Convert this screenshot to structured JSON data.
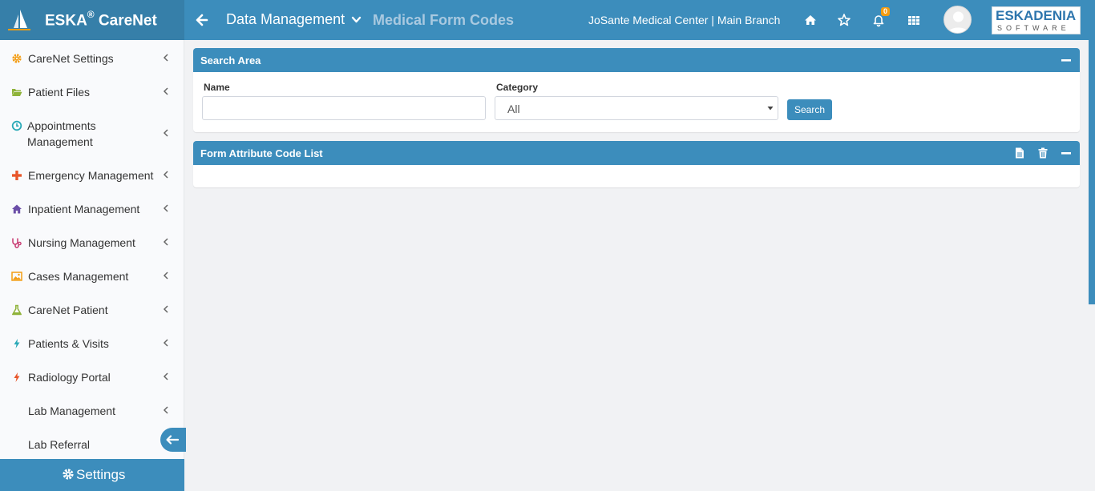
{
  "app": {
    "brand": "ESKA",
    "brand_reg": "®",
    "brand_suffix": " CareNet"
  },
  "header": {
    "breadcrumb_main": "Data Management",
    "breadcrumb_sub": "Medical Form Codes",
    "center": "JoSante Medical Center | Main Branch",
    "notification_count": "0",
    "logo_line1": "ESKADENIA",
    "logo_line2": "SOFTWARE"
  },
  "sidebar": {
    "items": [
      {
        "label": "CareNet Settings",
        "icon": "cog-icon",
        "color": "#f39c12"
      },
      {
        "label": "Patient Files",
        "icon": "folder-open-icon",
        "color": "#8fb33a"
      },
      {
        "label": "Appointments",
        "label2": "Management",
        "icon": "clock-icon",
        "color": "#2aa9b7"
      },
      {
        "label": "Emergency Management",
        "icon": "plus-icon",
        "color": "#e8562a"
      },
      {
        "label": "Inpatient Management",
        "icon": "home-icon",
        "color": "#6b4ea8"
      },
      {
        "label": "Nursing Management",
        "icon": "stethoscope-icon",
        "color": "#c7366f"
      },
      {
        "label": "Cases Management",
        "icon": "image-icon",
        "color": "#f39c12"
      },
      {
        "label": "CareNet Patient",
        "icon": "flask-icon",
        "color": "#8fb33a"
      },
      {
        "label": "Patients & Visits",
        "icon": "bolt-icon",
        "color": "#2aa9b7"
      },
      {
        "label": "Radiology Portal",
        "icon": "bolt-icon",
        "color": "#e8562a"
      },
      {
        "label": "Lab Management",
        "icon": "",
        "color": ""
      },
      {
        "label": "Lab Referral",
        "icon": "",
        "color": ""
      }
    ],
    "settings_label": "Settings"
  },
  "search_area": {
    "title": "Search Area",
    "name_label": "Name",
    "name_value": "",
    "category_label": "Category",
    "category_value": "All",
    "search_button": "Search"
  },
  "code_list": {
    "title": "Form Attribute Code List"
  },
  "colors": {
    "primary": "#3c8dbc",
    "primary_dark": "#367fa9",
    "badge": "#f39c12"
  }
}
